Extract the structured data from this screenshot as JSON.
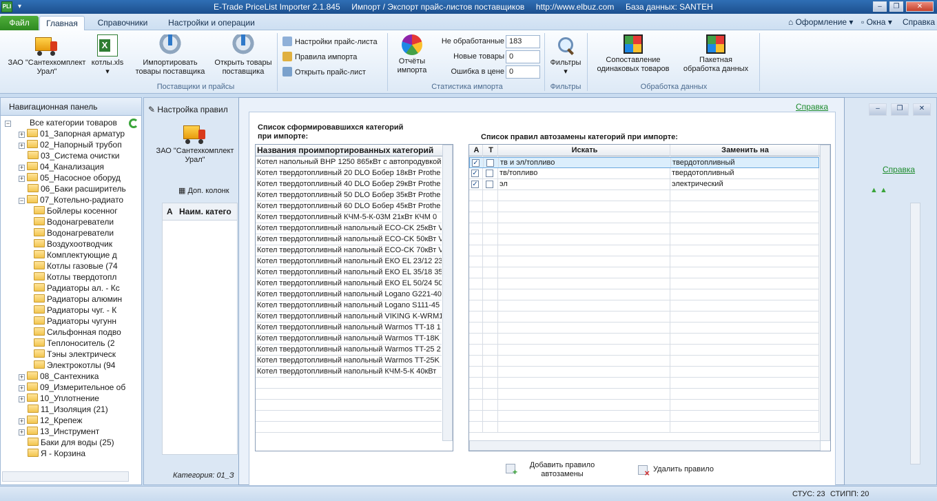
{
  "titlebar": {
    "title": "E-Trade PriceList Importer 2.1.845     Импорт / Экспорт прайс-листов поставщиков     http://www.elbuz.com     База данных: SANTEH"
  },
  "tabs": {
    "file": "Файл",
    "main": "Главная",
    "refs": "Справочники",
    "settings": "Настройки и операции"
  },
  "right_menu": {
    "design": "Оформление",
    "windows": "Окна",
    "help": "Справка"
  },
  "ribbon": {
    "supplier_btn": "ЗАО \"Сантехкомплект\nУрал\"",
    "file_btn": "котлы.xls",
    "import_goods": "Импортировать\nтовары поставщика",
    "open_goods": "Открыть товары\nпоставщика",
    "group_suppliers": "Поставщики и прайсы",
    "pricelist_settings": "Настройки прайс-листа",
    "import_rules": "Правила импорта",
    "open_pricelist": "Открыть прайс-лист",
    "reports": "Отчёты\nимпорта",
    "stat_not_processed_label": "Не обработанные",
    "stat_not_processed_value": "183",
    "stat_new_label": "Новые товары",
    "stat_new_value": "0",
    "stat_error_label": "Ошибка в цене",
    "stat_error_value": "0",
    "group_stats": "Статистика импорта",
    "filters": "Фильтры",
    "group_filters": "Фильтры",
    "compare": "Сопоставление\nодинаковых товаров",
    "batch": "Пакетная\nобработка данных",
    "group_processing": "Обработка данных"
  },
  "nav": {
    "title": "Навигационная панель",
    "items": [
      {
        "label": "Все категории товаров",
        "level": 0,
        "expander": "−"
      },
      {
        "label": "01_Запорная арматур",
        "level": 1,
        "expander": "+"
      },
      {
        "label": "02_Напорный трубоп",
        "level": 1,
        "expander": "+"
      },
      {
        "label": "03_Система очистки",
        "level": 1,
        "expander": ""
      },
      {
        "label": "04_Канализация",
        "level": 1,
        "expander": "+"
      },
      {
        "label": "05_Насосное оборуд",
        "level": 1,
        "expander": "+"
      },
      {
        "label": "06_Баки расширитель",
        "level": 1,
        "expander": ""
      },
      {
        "label": "07_Котельно-радиато",
        "level": 1,
        "expander": "−"
      },
      {
        "label": "Бойлеры косенног",
        "level": 2,
        "expander": ""
      },
      {
        "label": "Водонагреватели",
        "level": 2,
        "expander": ""
      },
      {
        "label": "Водонагреватели",
        "level": 2,
        "expander": ""
      },
      {
        "label": "Воздухоотводчик",
        "level": 2,
        "expander": ""
      },
      {
        "label": "Комплектующие д",
        "level": 2,
        "expander": ""
      },
      {
        "label": "Котлы газовые (74",
        "level": 2,
        "expander": ""
      },
      {
        "label": "Котлы твердотопл",
        "level": 2,
        "expander": ""
      },
      {
        "label": "Радиаторы ал. - Кс",
        "level": 2,
        "expander": ""
      },
      {
        "label": "Радиаторы алюмин",
        "level": 2,
        "expander": ""
      },
      {
        "label": "Радиаторы чуг. - К",
        "level": 2,
        "expander": ""
      },
      {
        "label": "Радиаторы чугунн",
        "level": 2,
        "expander": ""
      },
      {
        "label": "Сильфонная подво",
        "level": 2,
        "expander": ""
      },
      {
        "label": "Теплоноситель (2",
        "level": 2,
        "expander": ""
      },
      {
        "label": "Тэны электрическ",
        "level": 2,
        "expander": ""
      },
      {
        "label": "Электрокотлы (94",
        "level": 2,
        "expander": ""
      },
      {
        "label": "08_Сантехника",
        "level": 1,
        "expander": "+"
      },
      {
        "label": "09_Измерительное об",
        "level": 1,
        "expander": "+"
      },
      {
        "label": "10_Уплотнение",
        "level": 1,
        "expander": "+"
      },
      {
        "label": "11_Изоляция (21)",
        "level": 1,
        "expander": ""
      },
      {
        "label": "12_Крепеж",
        "level": 1,
        "expander": "+"
      },
      {
        "label": "13_Инструмент",
        "level": 1,
        "expander": "+"
      },
      {
        "label": "Баки для воды (25)",
        "level": 1,
        "expander": ""
      },
      {
        "label": "Я - Корзина",
        "level": 1,
        "expander": ""
      }
    ]
  },
  "bgwin": {
    "title": "Настройка правил",
    "supplier": "ЗАО \"Сантехкомплект\nУрал\"",
    "extra_columns": "Доп. колонк",
    "col_a": "А",
    "col_name": "Наим. катего",
    "help": "Справка",
    "category_footer": "Категория: 01_З"
  },
  "dialog": {
    "help": "Справка",
    "left_caption": "Список сформировавшихся категорий\nпри импорте:",
    "left_header": "Названия проимпортированных категорий",
    "left_rows": [
      "Котел  напольный ВНР 1250 865кВт с автопродувкой",
      "Котел твердотопливный 20 DLO Бобер 18кВт Prothe",
      "Котел твердотопливный 40 DLO Бобер 29кВт Prothe",
      "Котел твердотопливный 50 DLO Бобер 35кВт Prothe",
      "Котел твердотопливный 60 DLO Бобер 45кВт Prothe",
      "Котел твердотопливный КЧМ-5-К-03М 21кВт КЧМ 0",
      "Котел твердотопливный напольный ECO-CK 25кВт V",
      "Котел твердотопливный напольный ECO-CK 50кВт V",
      "Котел твердотопливный напольный ECO-CK 70кВт V",
      "Котел твердотопливный напольный ЕКО EL 23/12 23",
      "Котел твердотопливный напольный ЕКО EL 35/18 35",
      "Котел твердотопливный напольный ЕКО EL 50/24 50",
      "Котел твердотопливный напольный Logano G221-40",
      "Котел твердотопливный напольный Logano S111-45",
      "Котел твердотопливный напольный VIKING K-WRM1",
      "Котел твердотопливный напольный Warmos TT-18 1",
      "Котел твердотопливный напольный Warmos TT-18K",
      "Котел твердотопливный напольный Warmos TT-25 2",
      "Котел твердотопливный напольный Warmos TT-25K",
      "Котел твердотопливный напольный КЧМ-5-К 40кВт"
    ],
    "right_caption": "Список правил автозамены категорий при импорте:",
    "right_headers": {
      "a": "А",
      "t": "Т",
      "search": "Искать",
      "replace": "Заменить на"
    },
    "rules": [
      {
        "a": true,
        "t": false,
        "search": "тв и эл/топливо",
        "replace": "твердотопливный"
      },
      {
        "a": true,
        "t": false,
        "search": "тв/топливо",
        "replace": "твердотопливный"
      },
      {
        "a": true,
        "t": false,
        "search": "эл",
        "replace": "электрический"
      }
    ],
    "add_rule": "Добавить правило\nавтозамены",
    "delete_rule": "Удалить правило"
  },
  "status": {
    "stus": "СТУС: 23",
    "stipp": "СТИПП: 20"
  }
}
